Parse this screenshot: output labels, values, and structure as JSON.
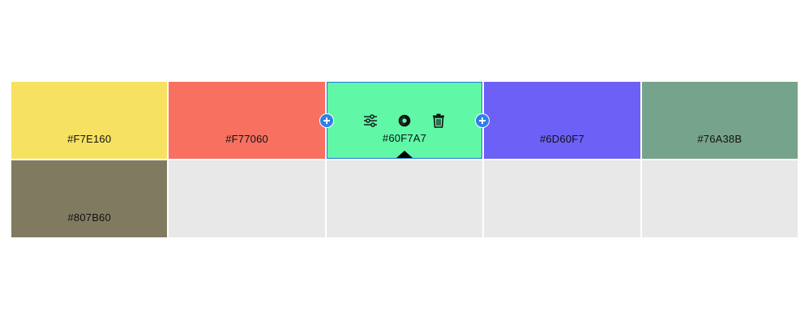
{
  "swatches": [
    {
      "hex": "#F7E160",
      "label": "#F7E160"
    },
    {
      "hex": "#F77060",
      "label": "#F77060"
    },
    {
      "hex": "#60F7A7",
      "label": "#60F7A7"
    },
    {
      "hex": "#6D60F7",
      "label": "#6D60F7"
    },
    {
      "hex": "#76A38B",
      "label": "#76A38B"
    },
    {
      "hex": "#807B60",
      "label": "#807B60"
    }
  ],
  "selected_index": 2,
  "empty_cell_color": "#E8E8E8",
  "toolbar": {
    "icons": [
      "sliders-icon",
      "contrast-icon",
      "trash-icon"
    ]
  },
  "add_button_color": "#2F7FE6"
}
